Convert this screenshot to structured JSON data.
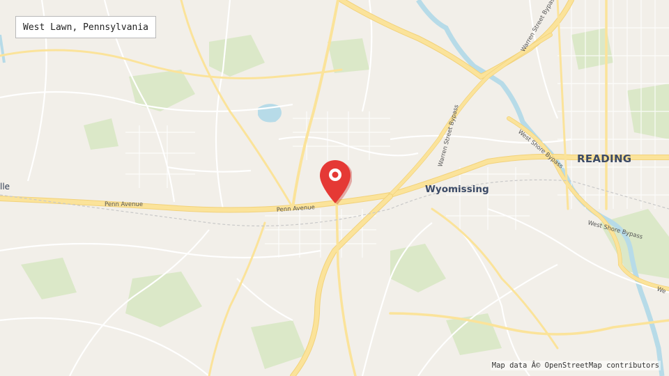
{
  "map": {
    "title": "West Lawn, Pennsylvania",
    "attribution": "Map data Â© OpenStreetMap contributors",
    "places": {
      "city": "READING",
      "town": "Wyomissing",
      "edge": "lle"
    },
    "road_labels": {
      "penn_avenue_west": "Penn Avenue",
      "penn_avenue_center": "Penn Avenue",
      "warren_bypass_south": "Warren Street Bypass",
      "warren_bypass_north": "Warren Street Bypass",
      "west_shore_bypass_north": "West Shore Bypass",
      "west_shore_bypass_south": "West Shore Bypass",
      "edge_we": "We"
    },
    "marker": {
      "label": "West Lawn location marker"
    },
    "colors": {
      "background": "#f2efe9",
      "major_road": "#fbe39a",
      "major_road_casing": "#f2d27a",
      "minor_road": "#ffffff",
      "park": "#dbe8c8",
      "water": "#b7dbe8",
      "marker": "#e53935"
    }
  }
}
